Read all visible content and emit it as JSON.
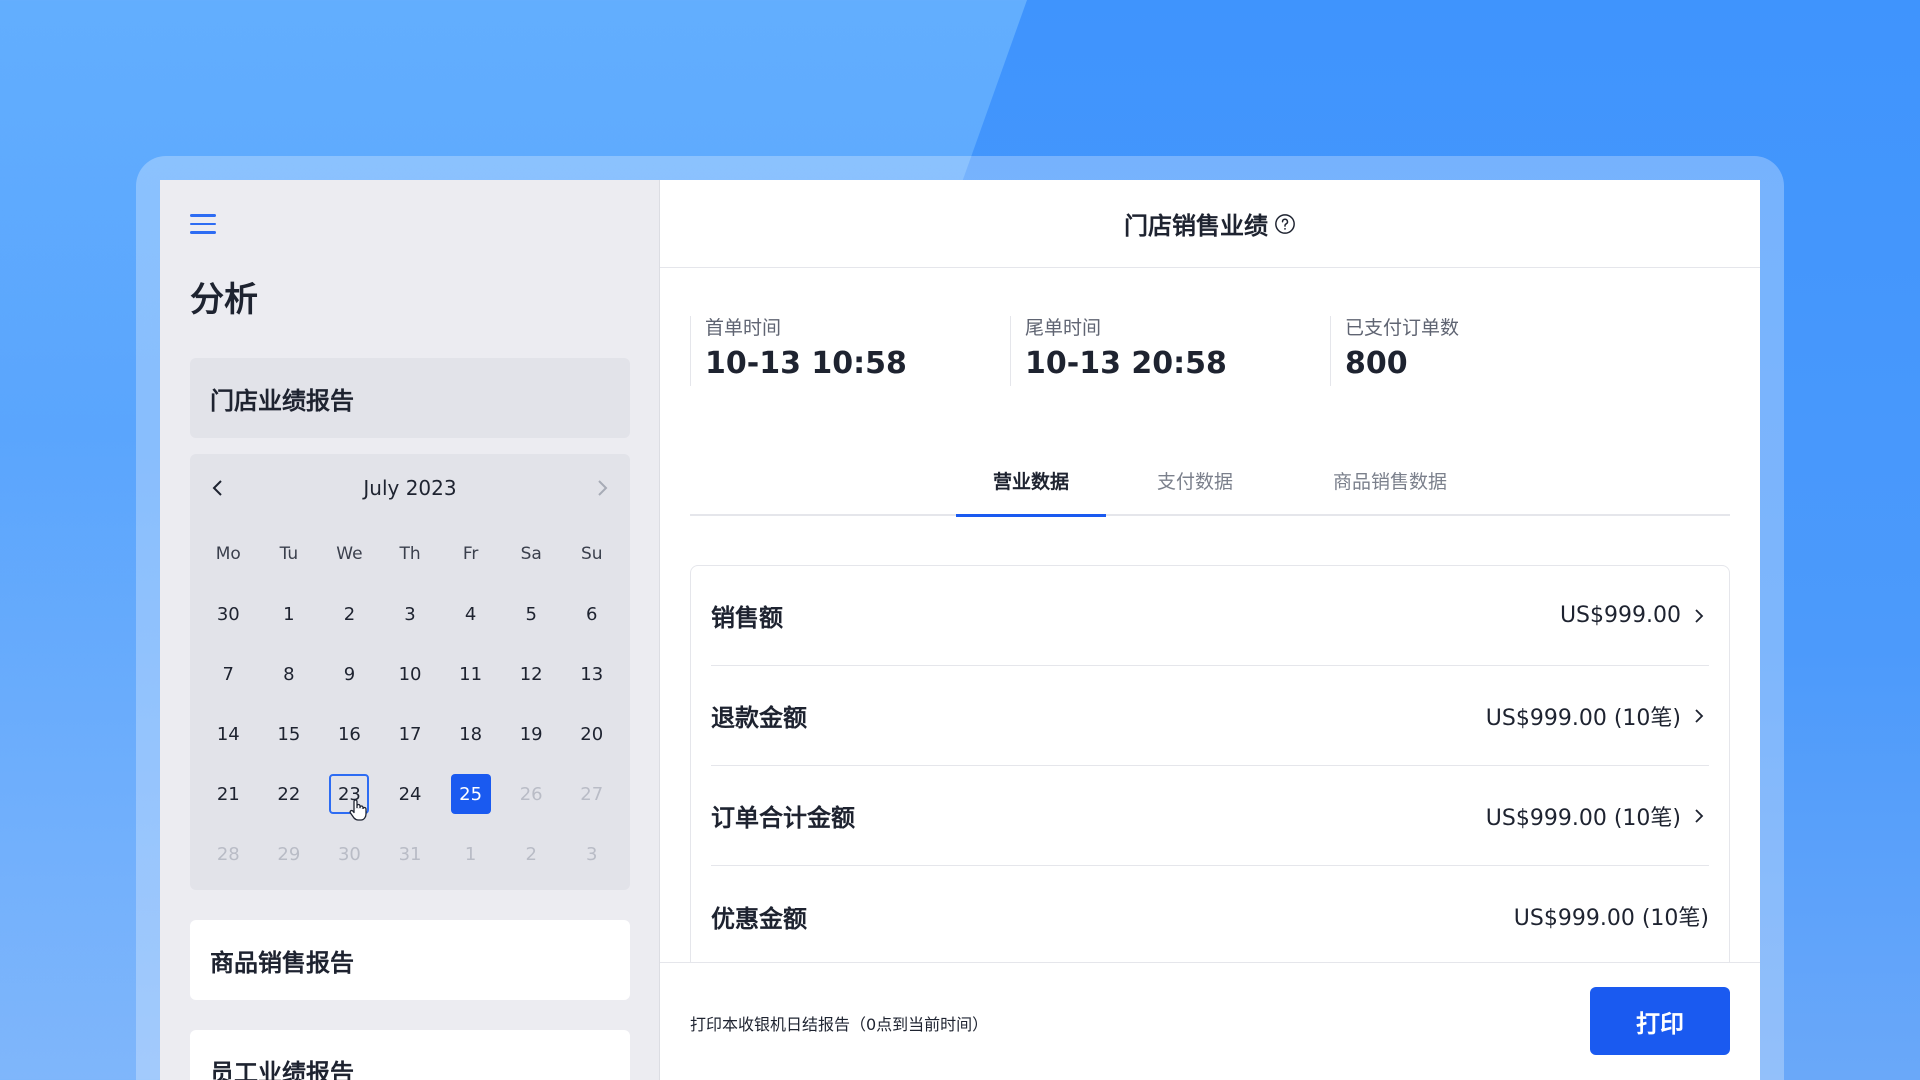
{
  "sidebar": {
    "title": "分析",
    "reports": [
      {
        "label": "门店业绩报告"
      },
      {
        "label": "商品销售报告"
      },
      {
        "label": "员工业绩报告"
      }
    ]
  },
  "calendar": {
    "month_label": "July 2023",
    "weekdays": [
      "Mo",
      "Tu",
      "We",
      "Th",
      "Fr",
      "Sa",
      "Su"
    ],
    "weeks": [
      [
        "30",
        "1",
        "2",
        "3",
        "4",
        "5",
        "6"
      ],
      [
        "7",
        "8",
        "9",
        "10",
        "11",
        "12",
        "13"
      ],
      [
        "14",
        "15",
        "16",
        "17",
        "18",
        "19",
        "20"
      ],
      [
        "21",
        "22",
        "23",
        "24",
        "25",
        "26",
        "27"
      ],
      [
        "28",
        "29",
        "30",
        "31",
        "1",
        "2",
        "3"
      ]
    ],
    "hovered_day": "23",
    "selected_day": "25",
    "accent_color": "#1a5af0"
  },
  "main": {
    "title": "门店销售业绩",
    "stats": [
      {
        "label": "首单时间",
        "value": "10-13 10:58"
      },
      {
        "label": "尾单时间",
        "value": "10-13 20:58"
      },
      {
        "label": "已支付订单数",
        "value": "800"
      }
    ],
    "tabs": [
      {
        "label": "营业数据"
      },
      {
        "label": "支付数据"
      },
      {
        "label": "商品销售数据"
      }
    ],
    "rows": [
      {
        "label": "销售额",
        "value": "US$999.00"
      },
      {
        "label": "退款金额",
        "value": "US$999.00 (10笔)"
      },
      {
        "label": "订单合计金额",
        "value": "US$999.00 (10笔)"
      },
      {
        "label": "优惠金额",
        "value": "US$999.00 (10笔)"
      }
    ],
    "footer_text": "打印本收银机日结报告（0点到当前时间）",
    "print_label": "打印"
  }
}
